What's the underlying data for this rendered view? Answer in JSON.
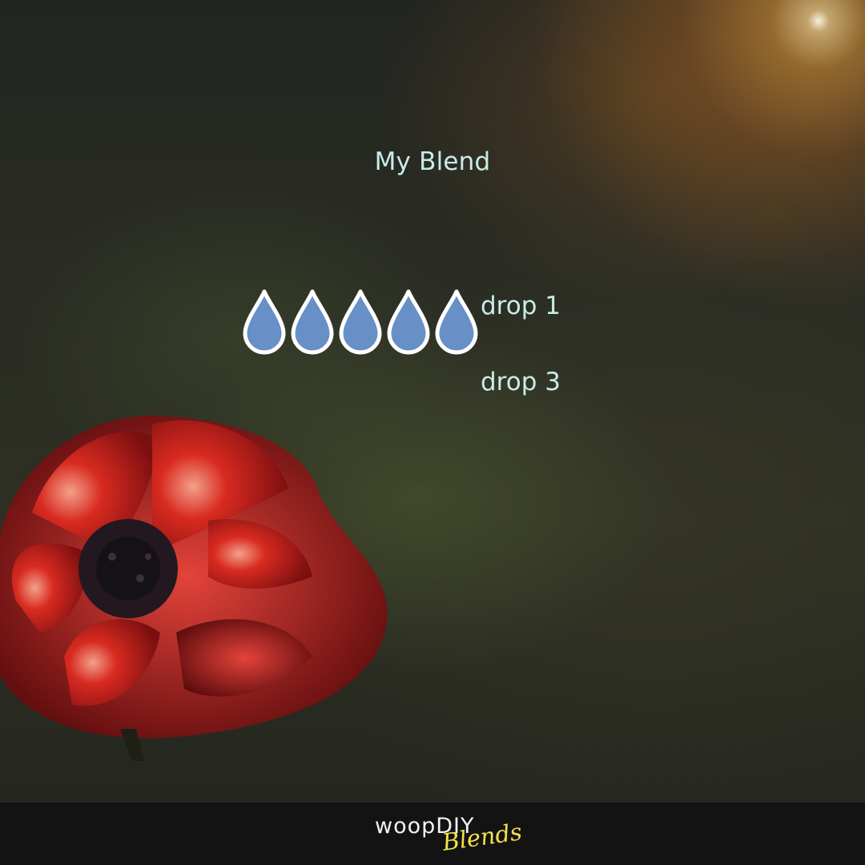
{
  "title": "My Blend",
  "drops": {
    "count": 5,
    "fill_color": "#6690c6",
    "outline_color": "#ffffff",
    "labels": [
      "drop 1",
      "drop 3"
    ]
  },
  "footer": {
    "logo_text": "woopDIY",
    "logo_script": "Blends",
    "logo_script_color": "#f5e24a"
  },
  "colors": {
    "text_accent": "#c8ece9",
    "footer_bg": "#121212"
  }
}
